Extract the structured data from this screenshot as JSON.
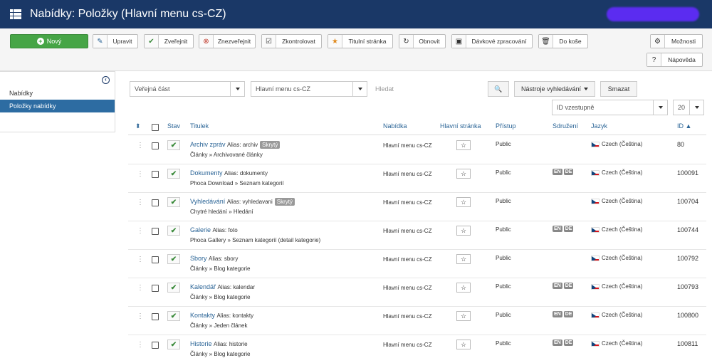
{
  "header": {
    "title": "Nabídky: Položky (Hlavní menu cs-CZ)"
  },
  "toolbar": {
    "new": "Nový",
    "edit": "Upravit",
    "publish": "Zveřejnit",
    "unpublish": "Znezveřejnit",
    "checkin": "Zkontrolovat",
    "home": "Titulní stránka",
    "rebuild": "Obnovit",
    "batch": "Dávkové zpracování",
    "trash": "Do koše",
    "options": "Možnosti",
    "help": "Nápověda"
  },
  "sidebar": {
    "items": [
      {
        "label": "Nabídky",
        "active": false
      },
      {
        "label": "Položky nabídky",
        "active": true
      }
    ]
  },
  "filters": {
    "access": "Veřejná část",
    "menu": "Hlavní menu cs-CZ",
    "search_placeholder": "Hledat",
    "tools": "Nástroje vyhledávání",
    "clear": "Smazat",
    "sort": "ID vzestupně",
    "limit": "20"
  },
  "table": {
    "headers": {
      "status": "Stav",
      "title": "Titulek",
      "menu": "Nabídka",
      "home": "Hlavní stránka",
      "access": "Přístup",
      "assoc": "Sdružení",
      "lang": "Jazyk",
      "id": "ID"
    },
    "rows": [
      {
        "title": "Archiv zpráv",
        "alias": "Alias: archiv",
        "hidden": "Skrytý",
        "sub": "Články » Archivované články",
        "menu": "Hlavní menu cs-CZ",
        "access": "Public",
        "assoc": [],
        "lang": "Czech (Čeština)",
        "id": "80"
      },
      {
        "title": "Dokumenty",
        "alias": "Alias: dokumenty",
        "hidden": "",
        "sub": "Phoca Download » Seznam kategorií",
        "menu": "Hlavní menu cs-CZ",
        "access": "Public",
        "assoc": [
          "EN",
          "DE"
        ],
        "lang": "Czech (Čeština)",
        "id": "100091"
      },
      {
        "title": "Vyhledávání",
        "alias": "Alias: vyhledavani",
        "hidden": "Skrytý",
        "sub": "Chytré hledání » Hledání",
        "menu": "Hlavní menu cs-CZ",
        "access": "Public",
        "assoc": [],
        "lang": "Czech (Čeština)",
        "id": "100704"
      },
      {
        "title": "Galerie",
        "alias": "Alias: foto",
        "hidden": "",
        "sub": "Phoca Gallery » Seznam kategorií (detail kategorie)",
        "menu": "Hlavní menu cs-CZ",
        "access": "Public",
        "assoc": [
          "EN",
          "DE"
        ],
        "lang": "Czech (Čeština)",
        "id": "100744"
      },
      {
        "title": "Sbory",
        "alias": "Alias: sbory",
        "hidden": "",
        "sub": "Články » Blog kategorie",
        "menu": "Hlavní menu cs-CZ",
        "access": "Public",
        "assoc": [],
        "lang": "Czech (Čeština)",
        "id": "100792"
      },
      {
        "title": "Kalendář",
        "alias": "Alias: kalendar",
        "hidden": "",
        "sub": "Články » Blog kategorie",
        "menu": "Hlavní menu cs-CZ",
        "access": "Public",
        "assoc": [
          "EN",
          "DE"
        ],
        "lang": "Czech (Čeština)",
        "id": "100793"
      },
      {
        "title": "Kontakty",
        "alias": "Alias: kontakty",
        "hidden": "",
        "sub": "Články » Jeden článek",
        "menu": "Hlavní menu cs-CZ",
        "access": "Public",
        "assoc": [
          "EN",
          "DE"
        ],
        "lang": "Czech (Čeština)",
        "id": "100800"
      },
      {
        "title": "Historie",
        "alias": "Alias: historie",
        "hidden": "",
        "sub": "Články » Blog kategorie",
        "menu": "Hlavní menu cs-CZ",
        "access": "Public",
        "assoc": [
          "EN",
          "DE"
        ],
        "lang": "Czech (Čeština)",
        "id": "100811"
      }
    ]
  }
}
